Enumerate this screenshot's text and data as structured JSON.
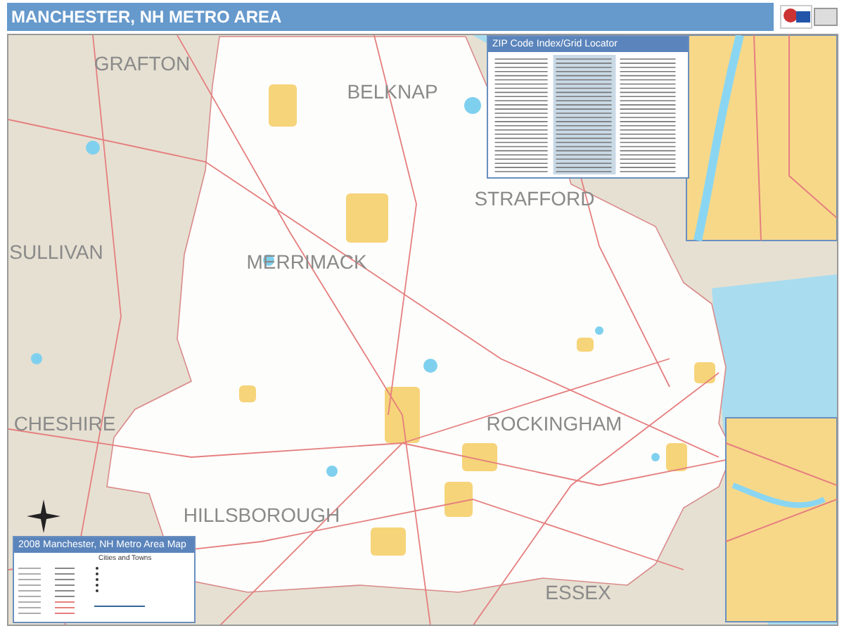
{
  "header": {
    "title": "MANCHESTER, NH METRO AREA"
  },
  "map": {
    "county_labels": [
      "GRAFTON",
      "BELKNAP",
      "SULLIVAN",
      "MERRIMACK",
      "STRAFFORD",
      "ROCKINGHAM",
      "CHESHIRE",
      "HILLSBOROUGH",
      "ESSEX"
    ]
  },
  "zip_index": {
    "title": "ZIP Code Index/Grid Locator"
  },
  "legend": {
    "title": "2008 Manchester, NH Metro Area Map",
    "subtitle": "Cities and Towns"
  }
}
